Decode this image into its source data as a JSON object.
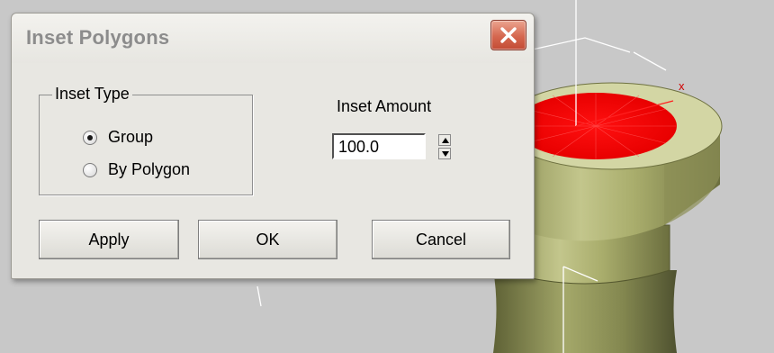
{
  "dialog": {
    "title": "Inset Polygons",
    "close_icon": "close-x-icon",
    "inset_type": {
      "label": "Inset Type",
      "options": [
        {
          "label": "Group",
          "checked": true
        },
        {
          "label": "By Polygon",
          "checked": false
        }
      ]
    },
    "inset_amount": {
      "label": "Inset Amount",
      "value": "100.0"
    },
    "buttons": {
      "apply": "Apply",
      "ok": "OK",
      "cancel": "Cancel"
    }
  },
  "viewport": {
    "axis_label": "x",
    "selected_face_color": "#ff0000",
    "model_color": "#b4b878",
    "background_color": "#c8c8c8"
  }
}
